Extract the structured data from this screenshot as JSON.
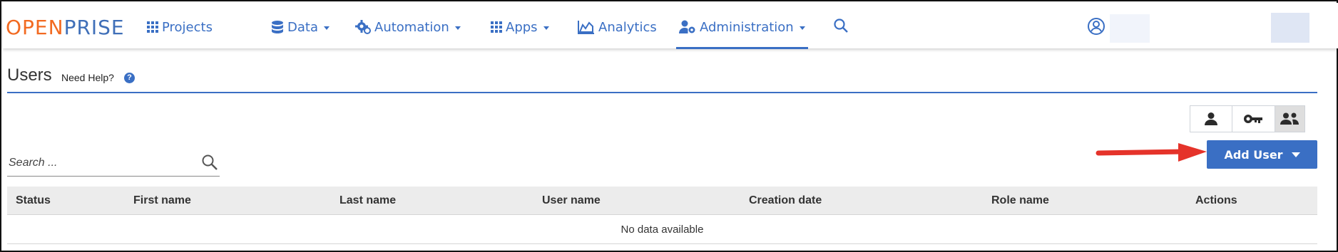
{
  "logo": {
    "part1": "OPEN",
    "part2": "PRISE"
  },
  "nav": {
    "projects": "Projects",
    "data": "Data",
    "automation": "Automation",
    "apps": "Apps",
    "analytics": "Analytics",
    "administration": "Administration"
  },
  "page": {
    "title": "Users",
    "help": "Need Help?",
    "help_glyph": "?"
  },
  "search": {
    "placeholder": "Search ..."
  },
  "add_user": {
    "label": "Add User"
  },
  "table": {
    "columns": [
      "Status",
      "First name",
      "Last name",
      "User name",
      "Creation date",
      "Role name",
      "Actions"
    ],
    "empty": "No data available"
  },
  "colors": {
    "accent": "#3a6fc4",
    "logo_orange": "#f26a21",
    "arrow_red": "#e5332a"
  },
  "icons": {
    "toggles": [
      "person-icon",
      "key-icon",
      "people-icon"
    ]
  }
}
